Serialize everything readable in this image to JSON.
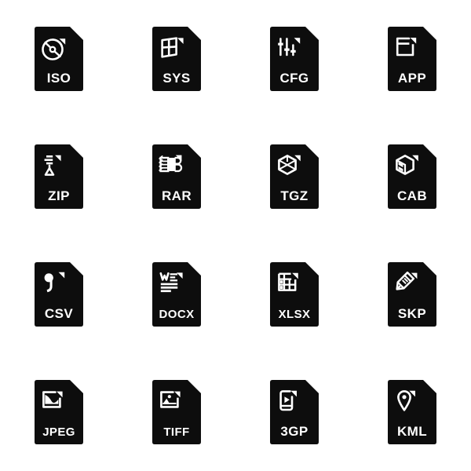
{
  "sheet": {
    "title": "File Type Icons",
    "background_color": "#ffffff",
    "icon_color": "#0d0d0d",
    "glyph_color": "#ffffff",
    "columns": 4,
    "rows": 4
  },
  "icons": [
    {
      "label": "ISO",
      "glyph": "disc-icon",
      "row": 1,
      "col": 1
    },
    {
      "label": "SYS",
      "glyph": "window-grid-icon",
      "row": 1,
      "col": 2
    },
    {
      "label": "CFG",
      "glyph": "sliders-icon",
      "row": 1,
      "col": 3
    },
    {
      "label": "APP",
      "glyph": "app-window-icon",
      "row": 1,
      "col": 4
    },
    {
      "label": "ZIP",
      "glyph": "zipper-icon",
      "row": 2,
      "col": 1
    },
    {
      "label": "RAR",
      "glyph": "bound-archive-icon",
      "row": 2,
      "col": 2
    },
    {
      "label": "TGZ",
      "glyph": "cube-box-icon",
      "row": 2,
      "col": 3
    },
    {
      "label": "CAB",
      "glyph": "drawer-box-icon",
      "row": 2,
      "col": 4
    },
    {
      "label": "CSV",
      "glyph": "comma-icon",
      "row": 3,
      "col": 1
    },
    {
      "label": "DOCX",
      "glyph": "word-document-icon",
      "row": 3,
      "col": 2
    },
    {
      "label": "XLSX",
      "glyph": "spreadsheet-icon",
      "row": 3,
      "col": 3
    },
    {
      "label": "SKP",
      "glyph": "pencil-icon",
      "row": 3,
      "col": 4
    },
    {
      "label": "JPEG",
      "glyph": "photo-landscape-icon",
      "row": 4,
      "col": 1
    },
    {
      "label": "TIFF",
      "glyph": "photo-sun-icon",
      "row": 4,
      "col": 2
    },
    {
      "label": "3GP",
      "glyph": "phone-play-icon",
      "row": 4,
      "col": 3
    },
    {
      "label": "KML",
      "glyph": "map-pin-icon",
      "row": 4,
      "col": 4
    }
  ]
}
